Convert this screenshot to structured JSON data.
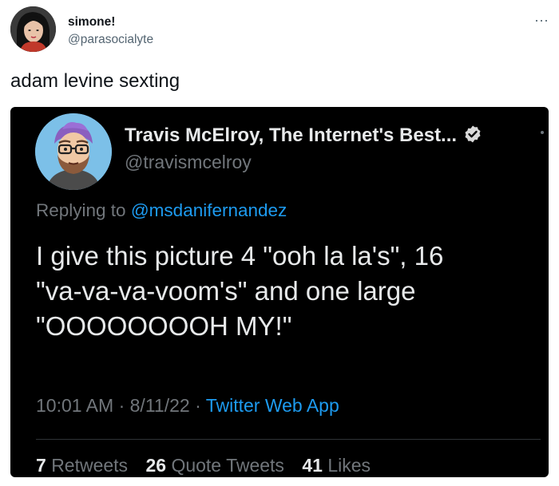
{
  "post": {
    "display_name": "simone!",
    "handle": "@parasocialyte",
    "text": "adam levine sexting",
    "more_icon": "···"
  },
  "screenshot": {
    "display_name": "Travis McElroy, The Internet's Best...",
    "handle": "@travismcelroy",
    "replying_prefix": "Replying to",
    "replying_to": "@msdanifernandez",
    "body": "I give this picture 4 \"ooh la la's\", 16\n\"va-va-va-voom's\" and one large\n\"OOOOOOOOH MY!\"",
    "time": "10:01 AM",
    "date": "8/11/22",
    "separator": "·",
    "app": "Twitter Web App",
    "retweets_count": "7",
    "retweets_label": "Retweets",
    "quotes_count": "26",
    "quotes_label": "Quote Tweets",
    "likes_count": "41",
    "likes_label": "Likes"
  },
  "colors": {
    "embed_bg": "#000000",
    "link_blue": "#1d9bf0",
    "muted_gray": "#71767b"
  }
}
